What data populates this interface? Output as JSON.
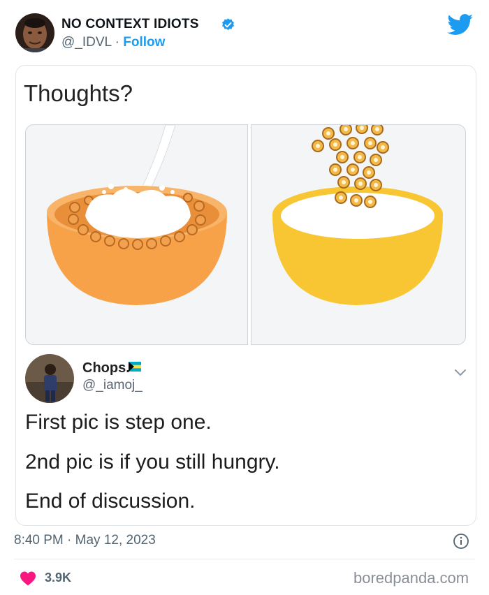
{
  "author": {
    "name": "NO CONTEXT IDIOTS",
    "handle": "@_IDVL",
    "separator": "·",
    "follow_label": "Follow"
  },
  "embedded_tweet": {
    "caption": "Thoughts?",
    "reply": {
      "name": "Chops.",
      "handle": "@_iamoj_",
      "lines": [
        "First pic is step one.",
        "2nd pic is if you still hungry.",
        "End of discussion."
      ]
    }
  },
  "footer": {
    "timestamp": "8:40 PM · May 12, 2023",
    "likes": "3.9K",
    "watermark": "boredpanda.com"
  },
  "colors": {
    "brand_blue": "#1d9bf0",
    "heart_red": "#f91880",
    "bowl_left": "#f7a148",
    "bowl_right": "#f8c632"
  },
  "icons": [
    "verified-badge-icon",
    "twitter-bird-icon",
    "chevron-down-icon",
    "info-icon",
    "heart-icon",
    "bahamas-flag-icon"
  ]
}
